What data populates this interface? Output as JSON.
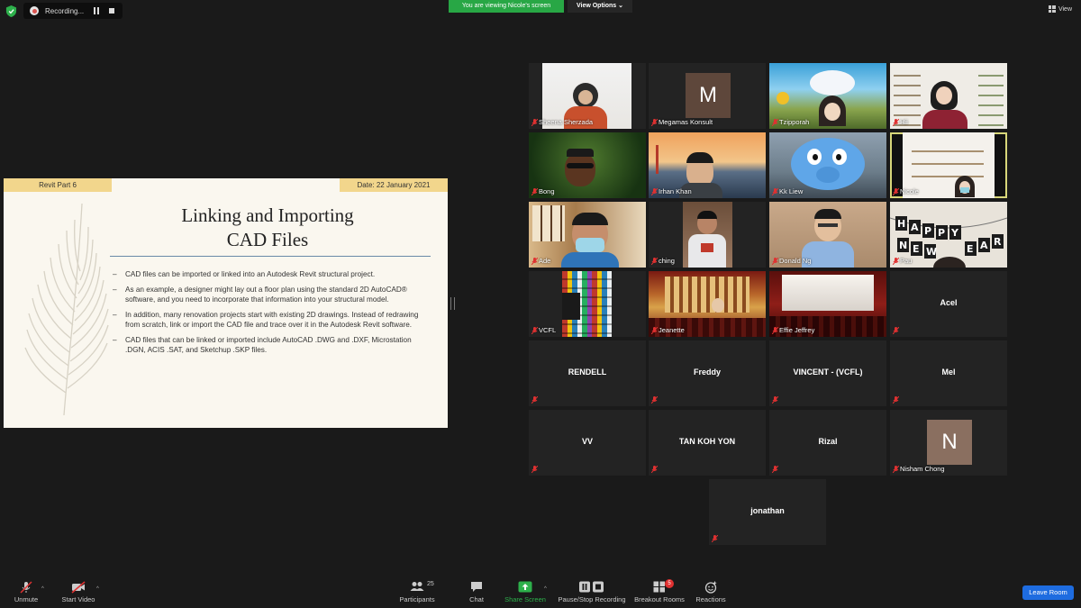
{
  "top_bar": {
    "recording_label": "Recording...",
    "viewing_banner": "You are viewing Nicole's screen",
    "view_options": "View Options",
    "view_button": "View"
  },
  "slide": {
    "tag_left": "Revit Part 6",
    "tag_right": "Date: 22 January 2021",
    "title_line1": "Linking and Importing",
    "title_line2": "CAD Files",
    "bullets": [
      "CAD files can be imported or linked into an Autodesk Revit structural project.",
      "As an example, a designer might lay out a floor plan using the standard 2D AutoCAD® software, and you need to incorporate that information into your structural model.",
      "In addition, many renovation projects start with existing 2D drawings. Instead of redrawing from scratch, link or import the CAD file and trace over it in the Autodesk Revit software.",
      "CAD files that can be linked or imported include AutoCAD .DWG and .DXF, Microstation .DGN, ACIS .SAT, and Sketchup .SKP files."
    ]
  },
  "participants": [
    {
      "name": "Sheena Sherzada"
    },
    {
      "name": "Megamas Konsult",
      "avatar_letter": "M",
      "avatar_color": "#5e473b"
    },
    {
      "name": "Tzipporah"
    },
    {
      "name": "Hii"
    },
    {
      "name": "Bong"
    },
    {
      "name": "Irhan Khan"
    },
    {
      "name": "Kk Liew"
    },
    {
      "name": "Nicole",
      "highlighted": true
    },
    {
      "name": "Ade"
    },
    {
      "name": "ching"
    },
    {
      "name": "Donald Ng"
    },
    {
      "name": "Pau"
    },
    {
      "name": "VCFL"
    },
    {
      "name": "Jeanette"
    },
    {
      "name": "Effie Jeffrey"
    },
    {
      "name": "Acel"
    },
    {
      "name": "RENDELL"
    },
    {
      "name": "Freddy"
    },
    {
      "name": "VINCENT - (VCFL)"
    },
    {
      "name": "Mel"
    },
    {
      "name": "VV"
    },
    {
      "name": "TAN KOH YON"
    },
    {
      "name": "Rizal"
    },
    {
      "name": "Nisham Chong",
      "avatar_letter": "N",
      "avatar_color": "#8a6f60"
    },
    {
      "name": "jonathan"
    }
  ],
  "video_captions": {
    "pau_banner": "HAPPY NEW YEAR"
  },
  "bottom_bar": {
    "unmute": "Unmute",
    "start_video": "Start Video",
    "participants": "Participants",
    "participants_count": "25",
    "chat": "Chat",
    "share_screen": "Share Screen",
    "recording": "Pause/Stop Recording",
    "breakout": "Breakout Rooms",
    "breakout_badge": "5",
    "reactions": "Reactions",
    "leave": "Leave Room"
  },
  "colors": {
    "accent_green": "#28a745",
    "leave_blue": "#1e6ce0",
    "mic_muted_red": "#e03131",
    "highlight": "#d8d77a"
  }
}
